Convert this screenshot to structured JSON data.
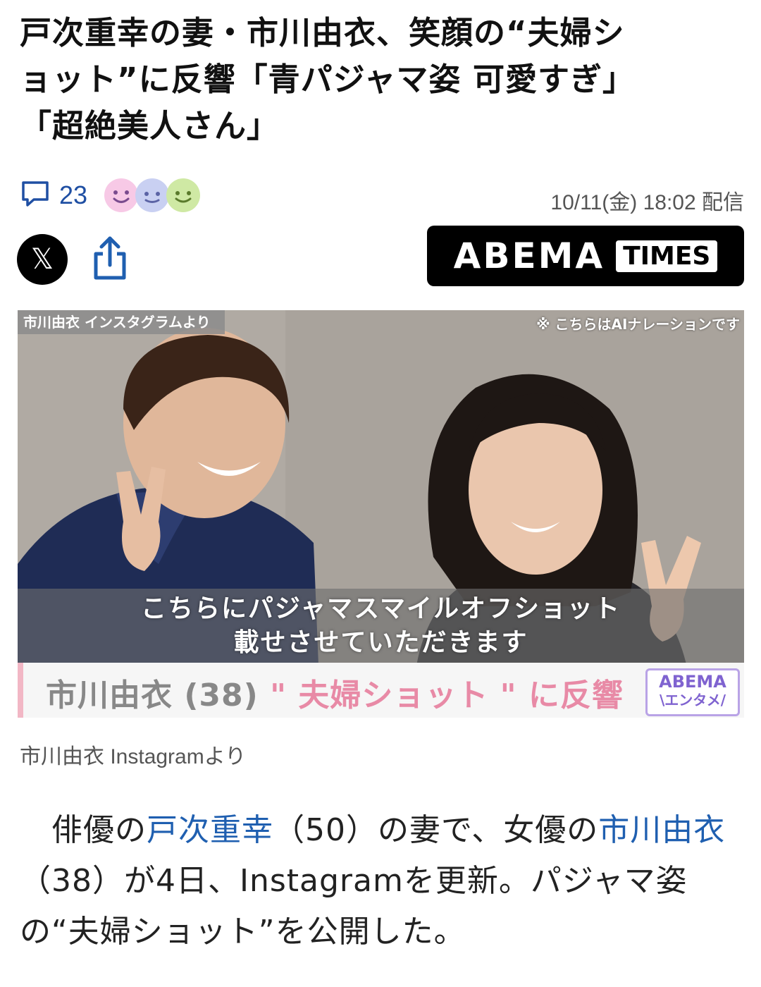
{
  "article": {
    "headline_line1": "戸次重幸の妻・市川由衣、笑顔の“夫婦シ",
    "headline_line2": "ョット”に反響「青パジャマ姿 可愛すぎ」",
    "headline_line3": "「超絶美人さん」",
    "comment_count": "23",
    "reaction_icons": [
      "smile-pink-icon",
      "smile-blue-icon",
      "smile-green-icon"
    ],
    "published": "10/11(金) 18:02 配信",
    "source_logo_main": "ABEMA",
    "source_logo_sub": "TIMES"
  },
  "share": {
    "x_glyph": "𝕏",
    "share_icon": "share-icon"
  },
  "photo": {
    "source_badge": "市川由衣 インスタグラムより",
    "ai_note": "※ こちらはAIナレーションです",
    "subtitle_line1": "こちらにパジャマスマイルオフショット",
    "subtitle_line2": "載せさせていただきます",
    "lower_third_name": "市川由衣 (38) ",
    "lower_third_topic": "\" 夫婦ショット \" に反響",
    "badge_line1": "ABEMA",
    "badge_line2": "\\エンタメ/",
    "caption": "市川由衣 Instagramより"
  },
  "body": {
    "p1_a": "　俳優の",
    "p1_link1": "戸次重幸",
    "p1_b": "（50）の妻で、女優の",
    "p1_link2": "市川由衣",
    "p1_c": "（38）が4日、Instagramを更新。パジャマ姿の“夫婦ショット”を公開した。"
  },
  "colors": {
    "link": "#1f5fb0",
    "comment_accent": "#1f4fa3",
    "brand_black": "#000000",
    "lower_third_pink": "#e88aa6",
    "badge_purple": "#7f63d0"
  }
}
